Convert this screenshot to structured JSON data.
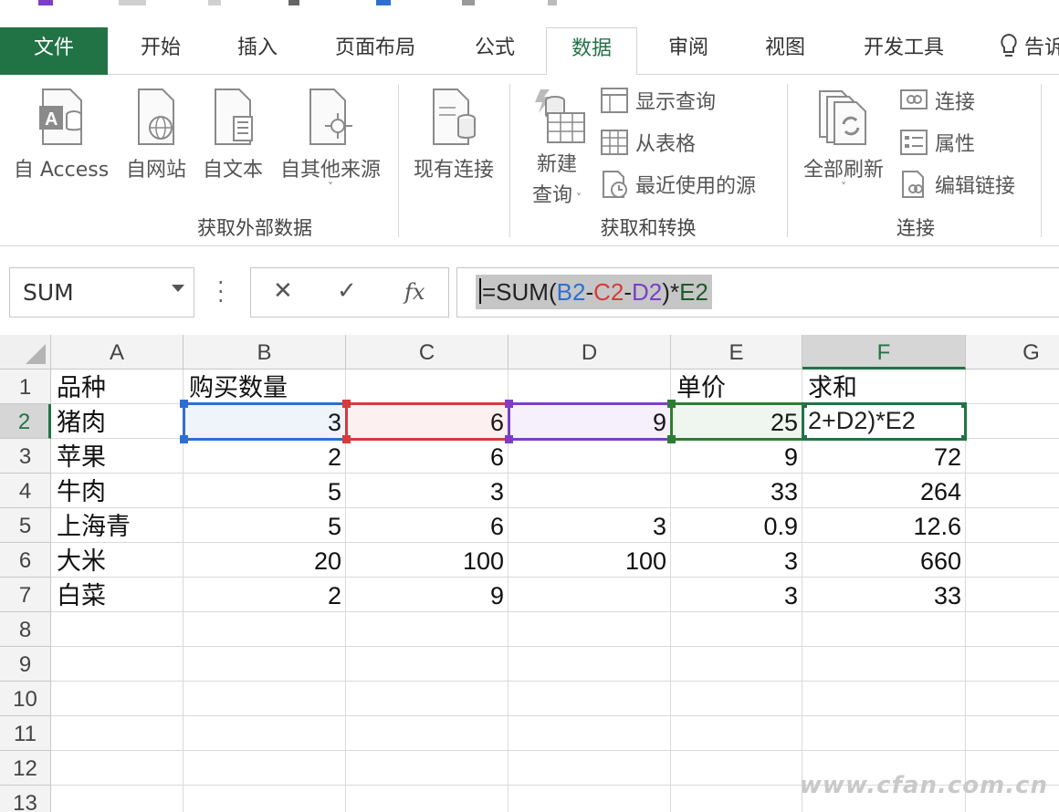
{
  "ribbon_tabs": [
    "文件",
    "开始",
    "插入",
    "页面布局",
    "公式",
    "数据",
    "审阅",
    "视图",
    "开发工具",
    "告诉"
  ],
  "active_tab": "数据",
  "groups": {
    "get_external": {
      "label": "获取外部数据",
      "buttons": [
        "自 Access",
        "自网站",
        "自文本",
        "自其他来源",
        "现有连接"
      ]
    },
    "get_transform": {
      "label": "获取和转换",
      "new_query_line1": "新建",
      "new_query_line2": "查询",
      "small": [
        "显示查询",
        "从表格",
        "最近使用的源"
      ]
    },
    "connections": {
      "label": "连接",
      "refresh_all": "全部刷新",
      "small": [
        "连接",
        "属性",
        "编辑链接"
      ]
    }
  },
  "formula_bar": {
    "name_box": "SUM",
    "formula": {
      "eq": "=SUM(",
      "b2": "B2",
      "op1": "-",
      "c2": "C2",
      "op2": "-",
      "d2": "D2",
      "tail": ")*",
      "e2": "E2"
    }
  },
  "columns": [
    "A",
    "B",
    "C",
    "D",
    "E",
    "F",
    "G"
  ],
  "rows": [
    "1",
    "2",
    "3",
    "4",
    "5",
    "6",
    "7",
    "8",
    "9",
    "10",
    "11",
    "12",
    "13"
  ],
  "cells": [
    [
      "品种",
      "购买数量",
      "",
      "",
      "单价",
      "求和"
    ],
    [
      "猪肉",
      "3",
      "6",
      "9",
      "25",
      ""
    ],
    [
      "苹果",
      "2",
      "6",
      "",
      "9",
      "72"
    ],
    [
      "牛肉",
      "5",
      "3",
      "",
      "33",
      "264"
    ],
    [
      "上海青",
      "5",
      "6",
      "3",
      "0.9",
      "12.6"
    ],
    [
      "大米",
      "20",
      "100",
      "100",
      "3",
      "660"
    ],
    [
      "白菜",
      "2",
      "9",
      "",
      "3",
      "33"
    ]
  ],
  "editing_cell_text": "2+D2)*E2",
  "colors": {
    "excel_green": "#217346",
    "ref_b2": "#2f6ed1",
    "ref_c2": "#d93a3a",
    "ref_d2": "#7b3fc6",
    "ref_e2": "#2e7d32"
  },
  "watermark": "www.cfan.com.cn"
}
